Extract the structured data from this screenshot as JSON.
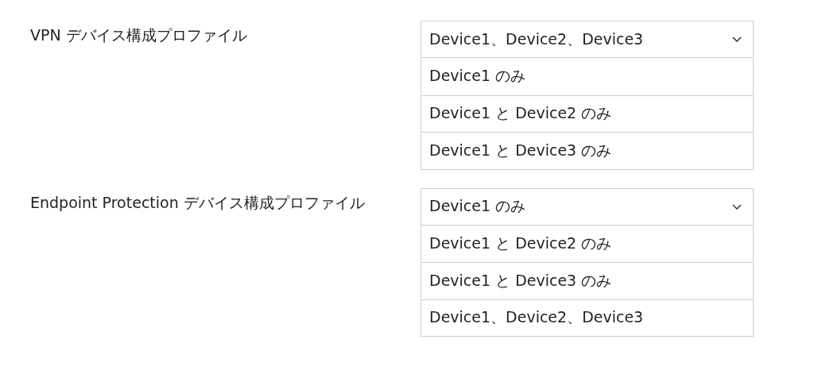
{
  "questions": [
    {
      "label": "VPN デバイス構成プロファイル",
      "value": "Device1、Device2、Device3",
      "options": [
        "Device1 のみ",
        "Device1 と Device2 のみ",
        "Device1 と Device3 のみ"
      ]
    },
    {
      "label": "Endpoint Protection デバイス構成プロファイル",
      "value": "Device1 のみ",
      "options": [
        "Device1 と Device2 のみ",
        "Device1 と Device3 のみ",
        "Device1、Device2、Device3"
      ]
    }
  ]
}
